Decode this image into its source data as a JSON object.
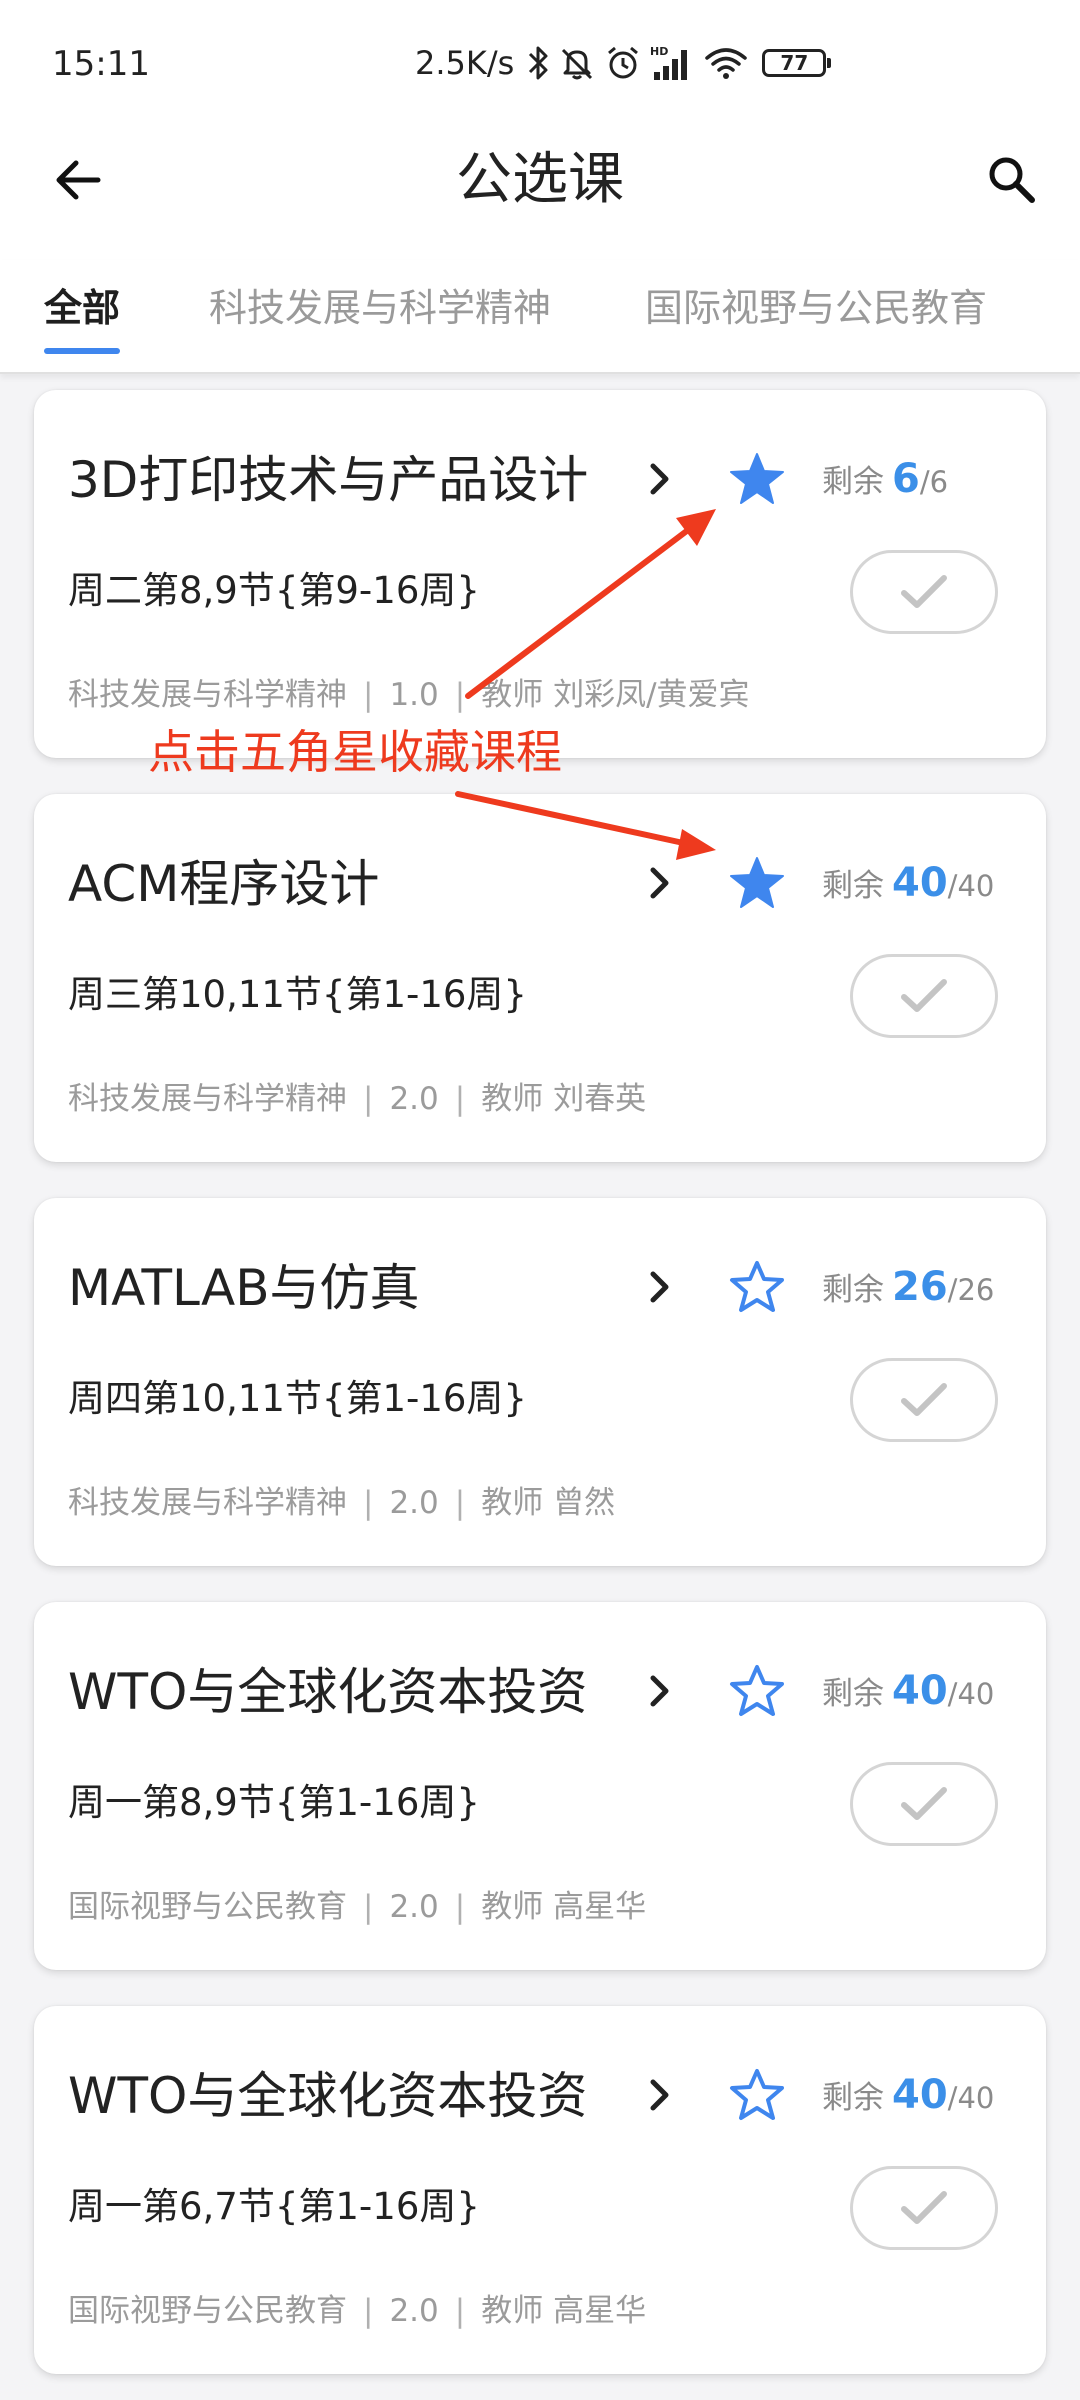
{
  "status_bar": {
    "time": "15:11",
    "network_speed": "2.5K/s",
    "icons": [
      "bluetooth-icon",
      "bell-off-icon",
      "alarm-icon",
      "hd-signal-icon",
      "wifi-icon"
    ],
    "battery": "77"
  },
  "header": {
    "title": "公选课",
    "back_icon": "arrow-left-icon",
    "search_icon": "search-icon"
  },
  "tabs": [
    {
      "label": "全部",
      "active": true
    },
    {
      "label": "科技发展与科学精神",
      "active": false
    },
    {
      "label": "国际视野与公民教育",
      "active": false
    }
  ],
  "colors": {
    "accent": "#3f86ee",
    "remaining_number": "#3b8fe8",
    "annotation": "#ee3a1e",
    "meta_text": "#9b9b9b"
  },
  "remain_label": "剩余",
  "courses": [
    {
      "title": "3D打印技术与产品设计",
      "favorited": true,
      "remaining": "6",
      "total": "/6",
      "schedule": "周二第8,9节{第9-16周}",
      "category": "科技发展与科学精神",
      "credit": "1.0",
      "teacher": "教师 刘彩凤/黄爱宾"
    },
    {
      "title": "ACM程序设计",
      "favorited": true,
      "remaining": "40",
      "total": "/40",
      "schedule": "周三第10,11节{第1-16周}",
      "category": "科技发展与科学精神",
      "credit": "2.0",
      "teacher": "教师 刘春英"
    },
    {
      "title": "MATLAB与仿真",
      "favorited": false,
      "remaining": "26",
      "total": "/26",
      "schedule": "周四第10,11节{第1-16周}",
      "category": "科技发展与科学精神",
      "credit": "2.0",
      "teacher": "教师 曾然"
    },
    {
      "title": "WTO与全球化资本投资",
      "favorited": false,
      "remaining": "40",
      "total": "/40",
      "schedule": "周一第8,9节{第1-16周}",
      "category": "国际视野与公民教育",
      "credit": "2.0",
      "teacher": "教师 高星华"
    },
    {
      "title": "WTO与全球化资本投资",
      "favorited": false,
      "remaining": "40",
      "total": "/40",
      "schedule": "周一第6,7节{第1-16周}",
      "category": "国际视野与公民教育",
      "credit": "2.0",
      "teacher": "教师 高星华"
    }
  ],
  "annotation": {
    "text": "点击五角星收藏课程"
  }
}
